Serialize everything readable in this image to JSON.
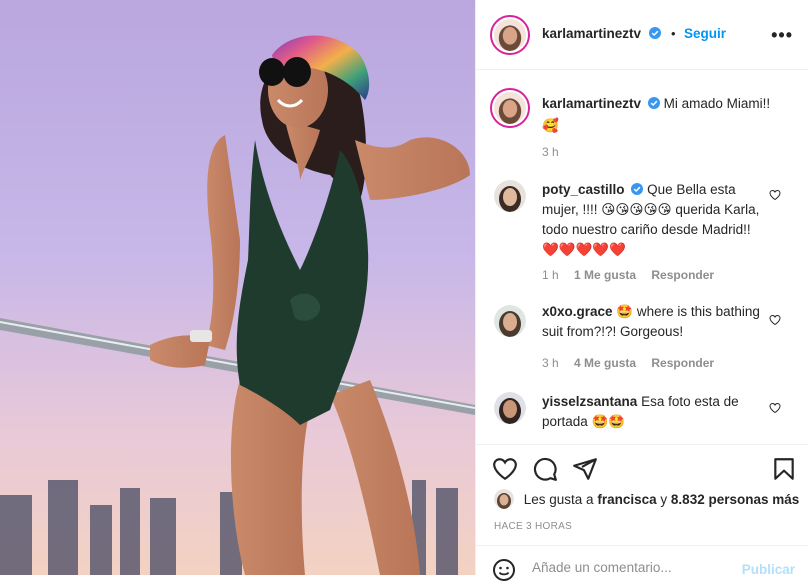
{
  "post": {
    "author": "karlamartineztv",
    "follow_label": "Seguir",
    "dot": "•",
    "more": "•••",
    "caption_text": "Mi amado Miami!!",
    "caption_time": "3 h"
  },
  "comments": [
    {
      "username": "poty_castillo",
      "text": "Que Bella esta mujer, !!!! 😘😘😘😘😘 querida Karla, todo nuestro cariño desde Madrid!! ❤️❤️❤️❤️❤️",
      "time": "1 h",
      "likes": "1 Me gusta",
      "reply": "Responder"
    },
    {
      "username": "x0xo.grace",
      "text": "🤩 where is this bathing suit from?!?! Gorgeous!",
      "time": "3 h",
      "likes": "4 Me gusta",
      "reply": "Responder"
    },
    {
      "username": "yisselzsantana",
      "text": "Esa foto esta de portada 🤩🤩"
    }
  ],
  "likes_line": {
    "prefix": "Les gusta a",
    "user": "francisca",
    "connector": "y",
    "count": "8.832 personas más"
  },
  "time_ago": "HACE 3 HORAS",
  "composer": {
    "placeholder": "Añade un comentario...",
    "publish_label": "Publicar"
  },
  "colors": {
    "accent": "#0095f6",
    "publish_disabled": "#b2dffc",
    "meta_gray": "#8e8e8e"
  }
}
